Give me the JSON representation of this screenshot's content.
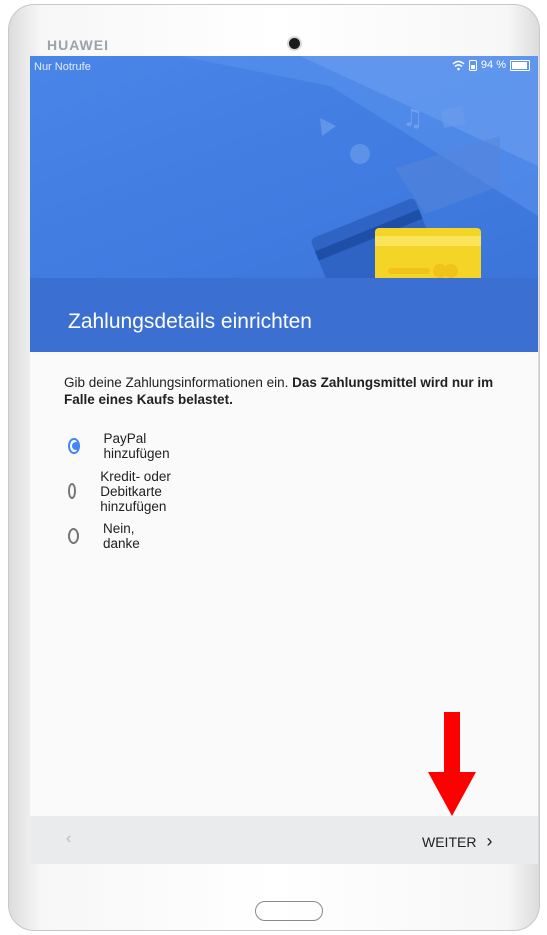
{
  "device": {
    "brand": "HUAWEI"
  },
  "status_bar": {
    "carrier_text": "Nur Notrufe",
    "battery": "94 %"
  },
  "header": {
    "title": "Zahlungsdetails einrichten"
  },
  "intro": {
    "text": "Gib deine Zahlungsinformationen ein. ",
    "bold_text": "Das Zahlungsmittel wird nur im Falle eines Kaufs belastet."
  },
  "options": [
    {
      "label": "PayPal hinzufügen",
      "selected": true
    },
    {
      "label": "Kredit- oder Debitkarte hinzufügen",
      "selected": false
    },
    {
      "label": "Nein, danke",
      "selected": false
    }
  ],
  "navigation": {
    "back_glyph": "‹",
    "next_label": "WEITER",
    "next_glyph": "›"
  },
  "colors": {
    "accent": "#4285f4",
    "header_blue": "#4a86e8",
    "annotation_arrow": "#ff0000"
  },
  "icons": [
    "camera-icon",
    "wifi-icon",
    "sim-icon",
    "battery-icon",
    "radio-selected-icon",
    "radio-unselected-icon",
    "chevron-left-icon",
    "chevron-right-icon",
    "red-arrow-down-icon"
  ]
}
